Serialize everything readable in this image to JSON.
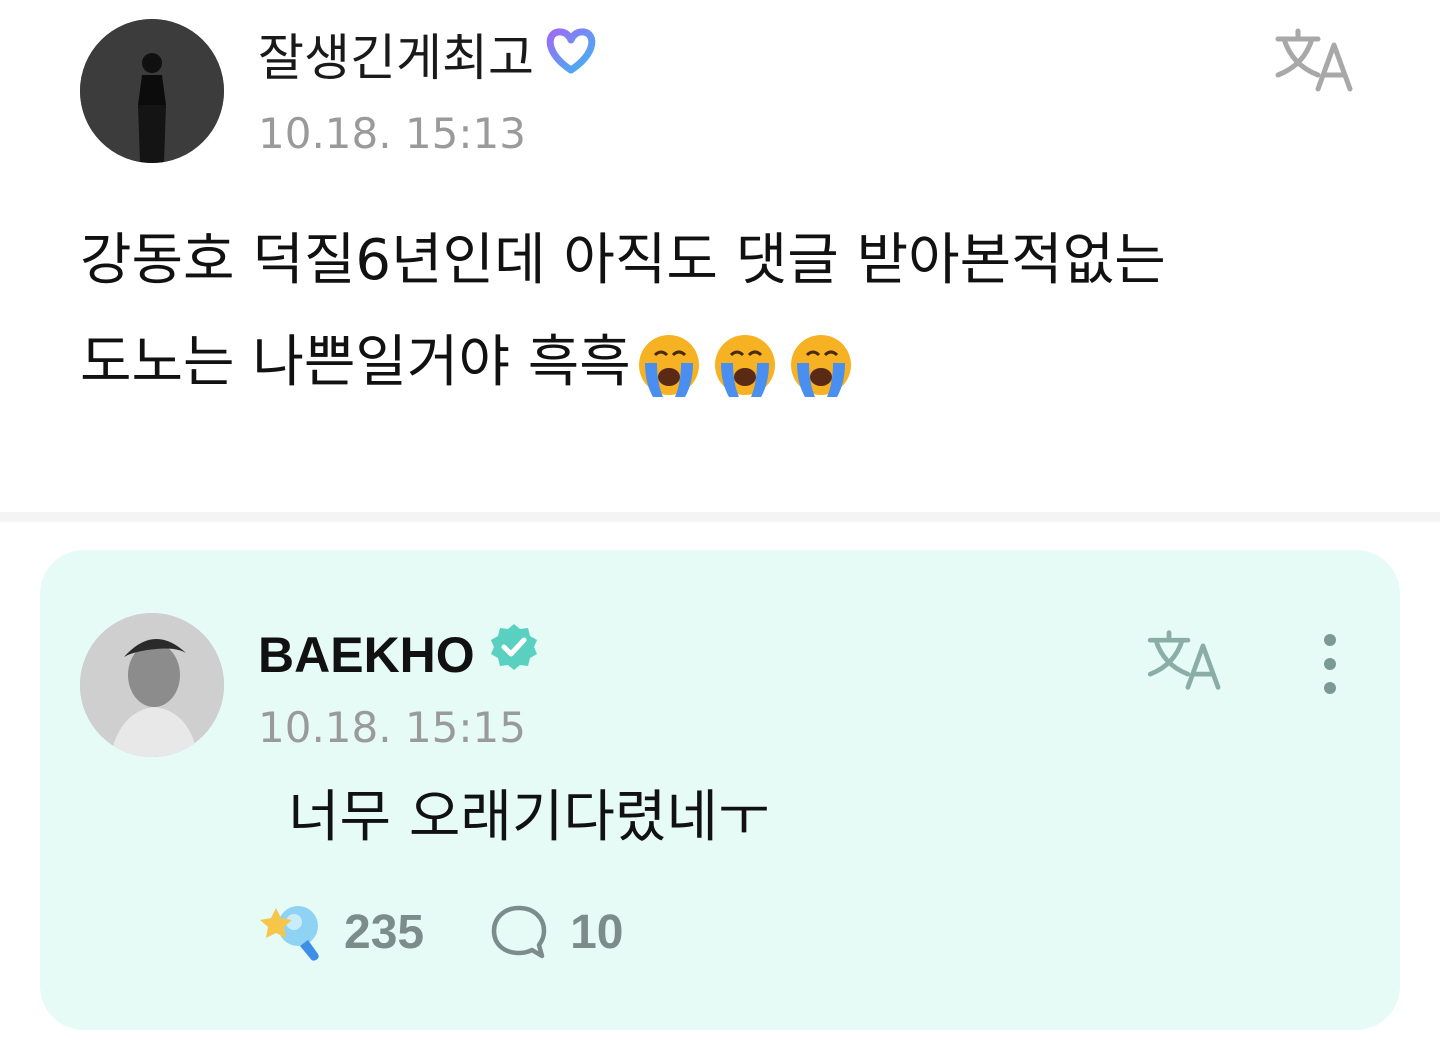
{
  "post": {
    "author": "잘생긴게최고",
    "timestamp": "10.18. 15:13",
    "body_line1": "강동호 덕질6년인데 아직도 댓글 받아본적없는",
    "body_line2": "도노는 나쁜일거야 흑흑",
    "emojis": [
      "loudly-crying-face",
      "loudly-crying-face",
      "loudly-crying-face"
    ],
    "badge_icon": "heart-membership-badge-icon"
  },
  "reply": {
    "author": "BAEKHO",
    "timestamp": "10.18. 15:15",
    "body": "너무 오래기다렸네ㅜ",
    "badge_icon": "verified-badge-icon",
    "like_count": "235",
    "comment_count": "10"
  },
  "colors": {
    "reply_background": "#e6faf6",
    "verified_badge": "#5ad1c0",
    "timestamp": "#9a9a9a",
    "action_text": "#7b8c8a"
  }
}
